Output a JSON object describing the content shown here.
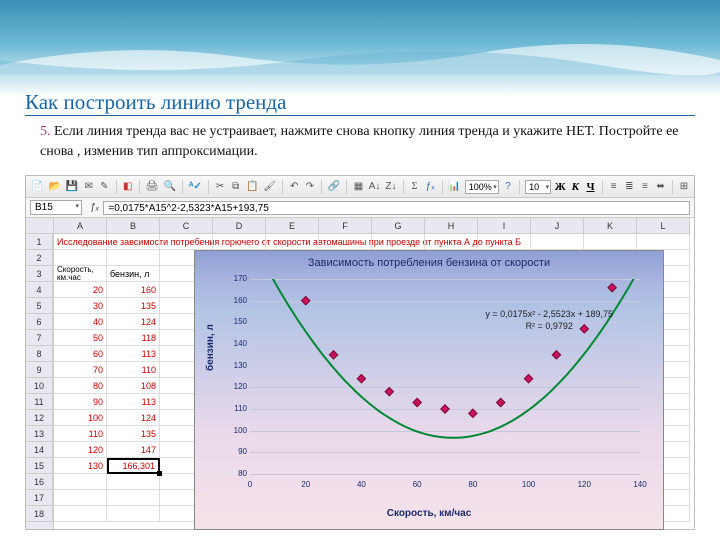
{
  "slide": {
    "title": "Как построить линию тренда",
    "num": "5.",
    "text": " Если линия тренда вас не устраивает, нажмите снова кнопку линия тренда и укажите НЕТ. Постройте ее снова , изменив тип аппроксимации."
  },
  "toolbar": {
    "zoom": "100%",
    "font_size": "10",
    "bold": "Ж",
    "italic": "К",
    "underline": "Ч"
  },
  "formula_bar": {
    "cell_ref": "B15",
    "formula": "=0,0175*A15^2-2,5323*A15+193,75"
  },
  "columns": [
    "A",
    "B",
    "C",
    "D",
    "E",
    "F",
    "G",
    "H",
    "I",
    "J",
    "K",
    "L"
  ],
  "rows": [
    "1",
    "2",
    "3",
    "4",
    "5",
    "6",
    "7",
    "8",
    "9",
    "10",
    "11",
    "12",
    "13",
    "14",
    "15",
    "16",
    "17",
    "18"
  ],
  "cells": {
    "row1_text": "Исследование завсимости потребения горючего от скорости автомашины при проезде от пункта А до пункта Б",
    "a3_1": "Скорость,",
    "a3_2": "км.час",
    "b3": "бензин, л",
    "dataA": [
      "20",
      "30",
      "40",
      "50",
      "60",
      "70",
      "80",
      "90",
      "100",
      "110",
      "120",
      "130"
    ],
    "dataB": [
      "160",
      "135",
      "124",
      "118",
      "113",
      "110",
      "108",
      "113",
      "124",
      "135",
      "147",
      "166,301"
    ]
  },
  "chart_data": {
    "type": "scatter",
    "title": "Зависимость потребления бензина от скорости",
    "xlabel": "Скорость, км/час",
    "ylabel": "бензин, л",
    "xlim": [
      0,
      140
    ],
    "ylim": [
      80,
      170
    ],
    "xticks": [
      0,
      20,
      40,
      60,
      80,
      100,
      120,
      140
    ],
    "yticks": [
      80,
      90,
      100,
      110,
      120,
      130,
      140,
      150,
      160,
      170
    ],
    "x": [
      20,
      30,
      40,
      50,
      60,
      70,
      80,
      90,
      100,
      110,
      120,
      130
    ],
    "y": [
      160,
      135,
      124,
      118,
      113,
      110,
      108,
      113,
      124,
      135,
      147,
      166
    ],
    "trend": {
      "type": "polynomial",
      "equation": "y = 0,0175x² - 2,5523x + 189,75",
      "r2": "R² = 0,9792",
      "a": 0.0175,
      "b": -2.5523,
      "c": 189.75
    }
  }
}
